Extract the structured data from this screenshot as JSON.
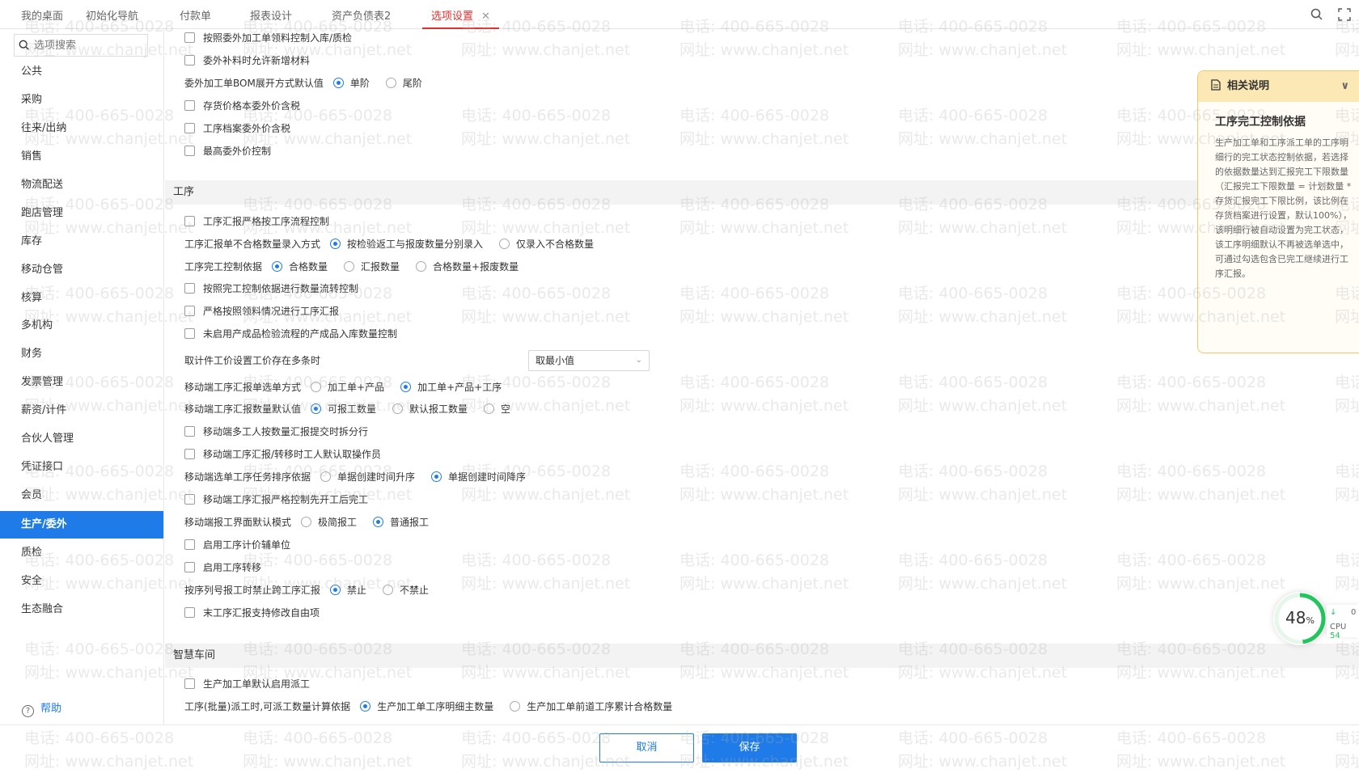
{
  "tabs": [
    {
      "label": "我的桌面"
    },
    {
      "label": "初始化导航"
    },
    {
      "label": "付款单"
    },
    {
      "label": "报表设计"
    },
    {
      "label": "资产负债表2"
    },
    {
      "label": "选项设置",
      "close": "✕"
    }
  ],
  "sidebar": {
    "search_placeholder": "选项搜索",
    "items": [
      "公共",
      "采购",
      "往来/出纳",
      "销售",
      "物流配送",
      "跑店管理",
      "库存",
      "移动仓管",
      "核算",
      "多机构",
      "财务",
      "发票管理",
      "薪资/计件",
      "合伙人管理",
      "凭证接口",
      "会员",
      "生产/委外",
      "质检",
      "安全",
      "生态融合"
    ],
    "active_item": "生产/委外",
    "help_label": "帮助"
  },
  "content": {
    "top_rows": [
      {
        "type": "checkbox",
        "label": "按照委外加工单领料控制入库/质检"
      },
      {
        "type": "checkbox",
        "label": "委外补料时允许新增材料"
      },
      {
        "type": "radio",
        "label": "委外加工单BOM展开方式默认值",
        "options": [
          {
            "label": "单阶",
            "checked": true
          },
          {
            "label": "尾阶",
            "checked": false
          }
        ]
      },
      {
        "type": "checkbox",
        "label": "存货价格本委外价含税"
      },
      {
        "type": "checkbox",
        "label": "工序档案委外价含税"
      },
      {
        "type": "checkbox",
        "label": "最高委外价控制"
      }
    ],
    "section_process": "工序",
    "process_rows": [
      {
        "type": "checkbox",
        "label": "工序汇报严格按工序流程控制"
      },
      {
        "type": "radio",
        "label": "工序汇报单不合格数量录入方式",
        "options": [
          {
            "label": "按检验返工与报废数量分别录入",
            "checked": true
          },
          {
            "label": "仅录入不合格数量",
            "checked": false
          }
        ]
      },
      {
        "type": "radio",
        "label": "工序完工控制依据",
        "options": [
          {
            "label": "合格数量",
            "checked": true
          },
          {
            "label": "汇报数量",
            "checked": false
          },
          {
            "label": "合格数量+报废数量",
            "checked": false
          }
        ]
      },
      {
        "type": "checkbox",
        "label": "按照完工控制依据进行数量流转控制"
      },
      {
        "type": "checkbox",
        "label": "严格按照领料情况进行工序汇报"
      },
      {
        "type": "checkbox",
        "label": "未启用产成品检验流程的产成品入库数量控制"
      },
      {
        "type": "select",
        "label": "取计件工价设置工价存在多条时",
        "value": "取最小值"
      },
      {
        "type": "radio",
        "label": "移动端工序汇报单选单方式",
        "options": [
          {
            "label": "加工单+产品",
            "checked": false
          },
          {
            "label": "加工单+产品+工序",
            "checked": true
          }
        ]
      },
      {
        "type": "radio",
        "label": "移动端工序汇报数量默认值",
        "options": [
          {
            "label": "可报工数量",
            "checked": true
          },
          {
            "label": "默认报工数量",
            "checked": false
          },
          {
            "label": "空",
            "checked": false
          }
        ]
      },
      {
        "type": "checkbox",
        "label": "移动端多工人按数量汇报提交时拆分行"
      },
      {
        "type": "checkbox",
        "label": "移动端工序汇报/转移时工人默认取操作员"
      },
      {
        "type": "radio",
        "label": "移动端选单工序任务排序依据",
        "options": [
          {
            "label": "单据创建时间升序",
            "checked": false
          },
          {
            "label": "单据创建时间降序",
            "checked": true
          }
        ]
      },
      {
        "type": "checkbox",
        "label": "移动端工序汇报严格控制先开工后完工"
      },
      {
        "type": "radio",
        "label": "移动端报工界面默认模式",
        "options": [
          {
            "label": "极简报工",
            "checked": false
          },
          {
            "label": "普通报工",
            "checked": true
          }
        ]
      },
      {
        "type": "checkbox",
        "label": "启用工序计价辅单位"
      },
      {
        "type": "checkbox",
        "label": "启用工序转移"
      },
      {
        "type": "radio",
        "label": "按序列号报工时禁止跨工序汇报",
        "options": [
          {
            "label": "禁止",
            "checked": true
          },
          {
            "label": "不禁止",
            "checked": false
          }
        ]
      },
      {
        "type": "checkbox",
        "label": "末工序汇报支持修改自由项"
      }
    ],
    "section_smart": "智慧车间",
    "smart_rows": [
      {
        "type": "checkbox",
        "label": "生产加工单默认启用派工"
      },
      {
        "type": "radio",
        "label": "工序(批量)派工时,可派工数量计算依据",
        "options": [
          {
            "label": "生产加工单工序明细主数量",
            "checked": true
          },
          {
            "label": "生产加工单前道工序累计合格数量",
            "checked": false
          }
        ]
      }
    ]
  },
  "panel": {
    "header": "相关说明",
    "title": "工序完工控制依据",
    "text": "生产加工单和工序派工单的工序明细行的完工状态控制依据，若选择的依据数量达到汇报完工下限数量（汇报完工下限数量 = 计划数量 * 存货汇报完工下限比例，该比例在存货档案进行设置，默认100%），该明细行被自动设置为完工状态，该工序明细默认不再被选单选中，可通过勾选包含已完工继续进行工序汇报。"
  },
  "cpu": {
    "percent": "48",
    "unit": "%",
    "label": "CPU",
    "value": "54",
    "extra": "0"
  },
  "footer": {
    "cancel_label": "取消",
    "save_label": "保存"
  },
  "watermark": {
    "phone": "电话: 400-665-0028",
    "site": "网址: www.chanjet.net"
  },
  "colors": {
    "accent": "#1e7be8",
    "active_tab": "#e0312f",
    "panel_header": "#fbe8b4",
    "cpu_ring": "#22c55e"
  }
}
